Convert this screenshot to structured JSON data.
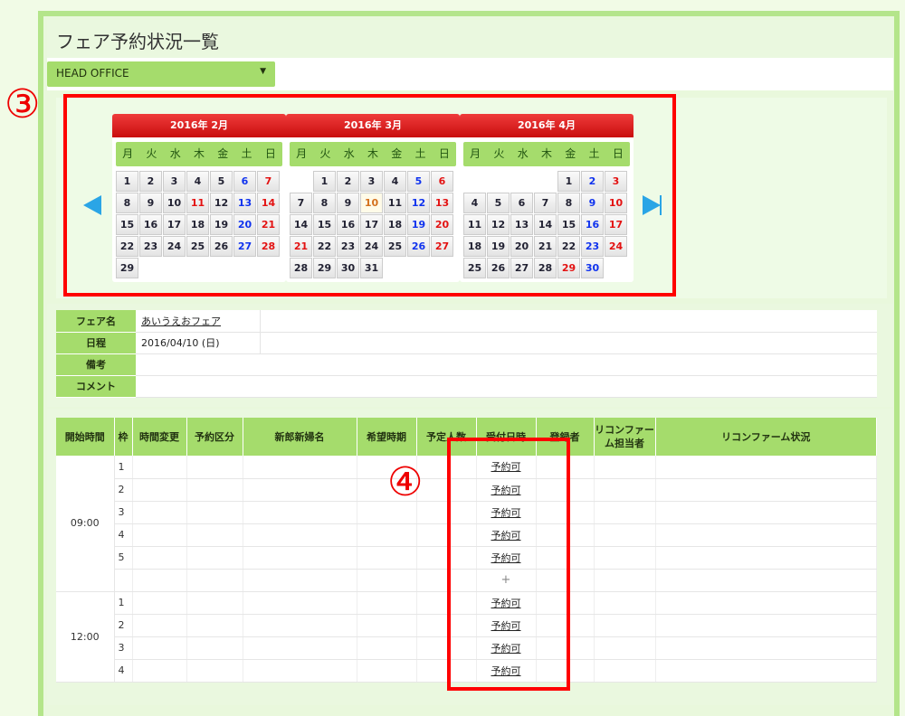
{
  "page": {
    "title": "フェア予約状況一覧"
  },
  "office": {
    "selected": "HEAD OFFICE"
  },
  "annotations": {
    "marker3": "③",
    "marker4": "④"
  },
  "calendar": {
    "weekdays": [
      "月",
      "火",
      "水",
      "木",
      "金",
      "土",
      "日"
    ],
    "months": [
      {
        "title": "2016年 2月",
        "offset": 0,
        "days": 29
      },
      {
        "title": "2016年 3月",
        "offset": 1,
        "days": 31
      },
      {
        "title": "2016年 4月",
        "offset": 4,
        "days": 30
      }
    ]
  },
  "fair_info": {
    "rows": [
      {
        "label": "フェア名",
        "value": "あいうえおフェア",
        "link": true
      },
      {
        "label": "日程",
        "value": "2016/04/10 (日)",
        "link": false
      },
      {
        "label": "備考",
        "value": "",
        "link": false
      },
      {
        "label": "コメント",
        "value": "",
        "link": false
      }
    ]
  },
  "schedule": {
    "columns": [
      "開始時間",
      "枠",
      "時間変更",
      "予約区分",
      "新郎新婦名",
      "希望時期",
      "予定人数",
      "受付日時",
      "登録者",
      "リコンファーム担当者",
      "リコンファーム状況"
    ],
    "blocks": [
      {
        "time": "09:00",
        "slots": [
          "1",
          "2",
          "3",
          "4",
          "5"
        ],
        "status": "予約可",
        "add": "+"
      },
      {
        "time": "12:00",
        "slots": [
          "1",
          "2",
          "3",
          "4"
        ],
        "status": "予約可",
        "add": ""
      }
    ]
  },
  "colors": {
    "accent_green": "#a5dc6c",
    "month_header_red": "#d81b1b",
    "highlight_red": "#ff0000",
    "nav_arrow_blue": "#2aa5e6"
  }
}
